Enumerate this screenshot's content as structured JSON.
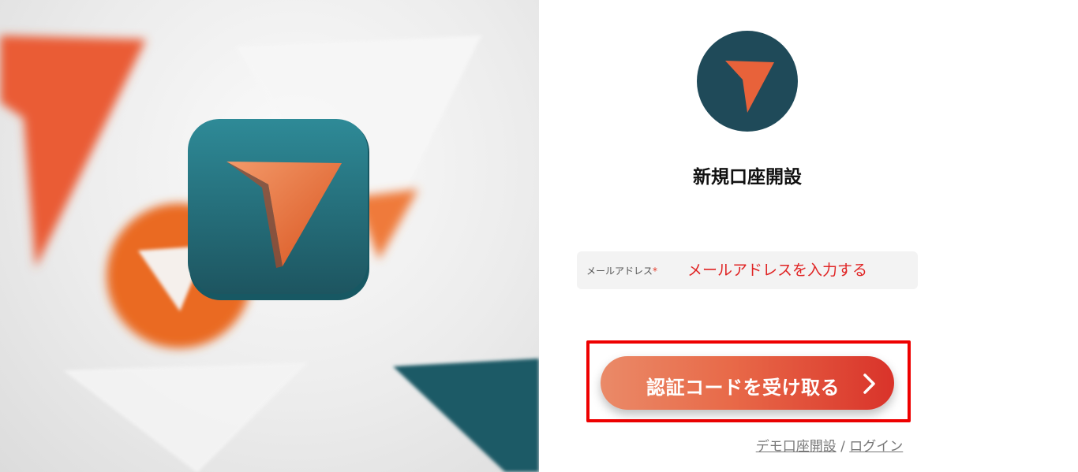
{
  "brand": {
    "accent": "#e8623a",
    "dark": "#1f4a59",
    "highlight": "#ee0000"
  },
  "hero": {
    "image": "abstract orange and teal arrow app icon illustration"
  },
  "panel": {
    "logo_icon": "arrow-logo-icon",
    "title": "新規口座開設",
    "email": {
      "label": "メールアドレス",
      "required_mark": "*",
      "value": "",
      "placeholder": "メールアドレスを入力する"
    },
    "submit": {
      "label": "認証コードを受け取る",
      "icon": "chevron-right-icon"
    },
    "links": {
      "demo": "デモ口座開設",
      "separator": " / ",
      "login": "ログイン"
    }
  }
}
